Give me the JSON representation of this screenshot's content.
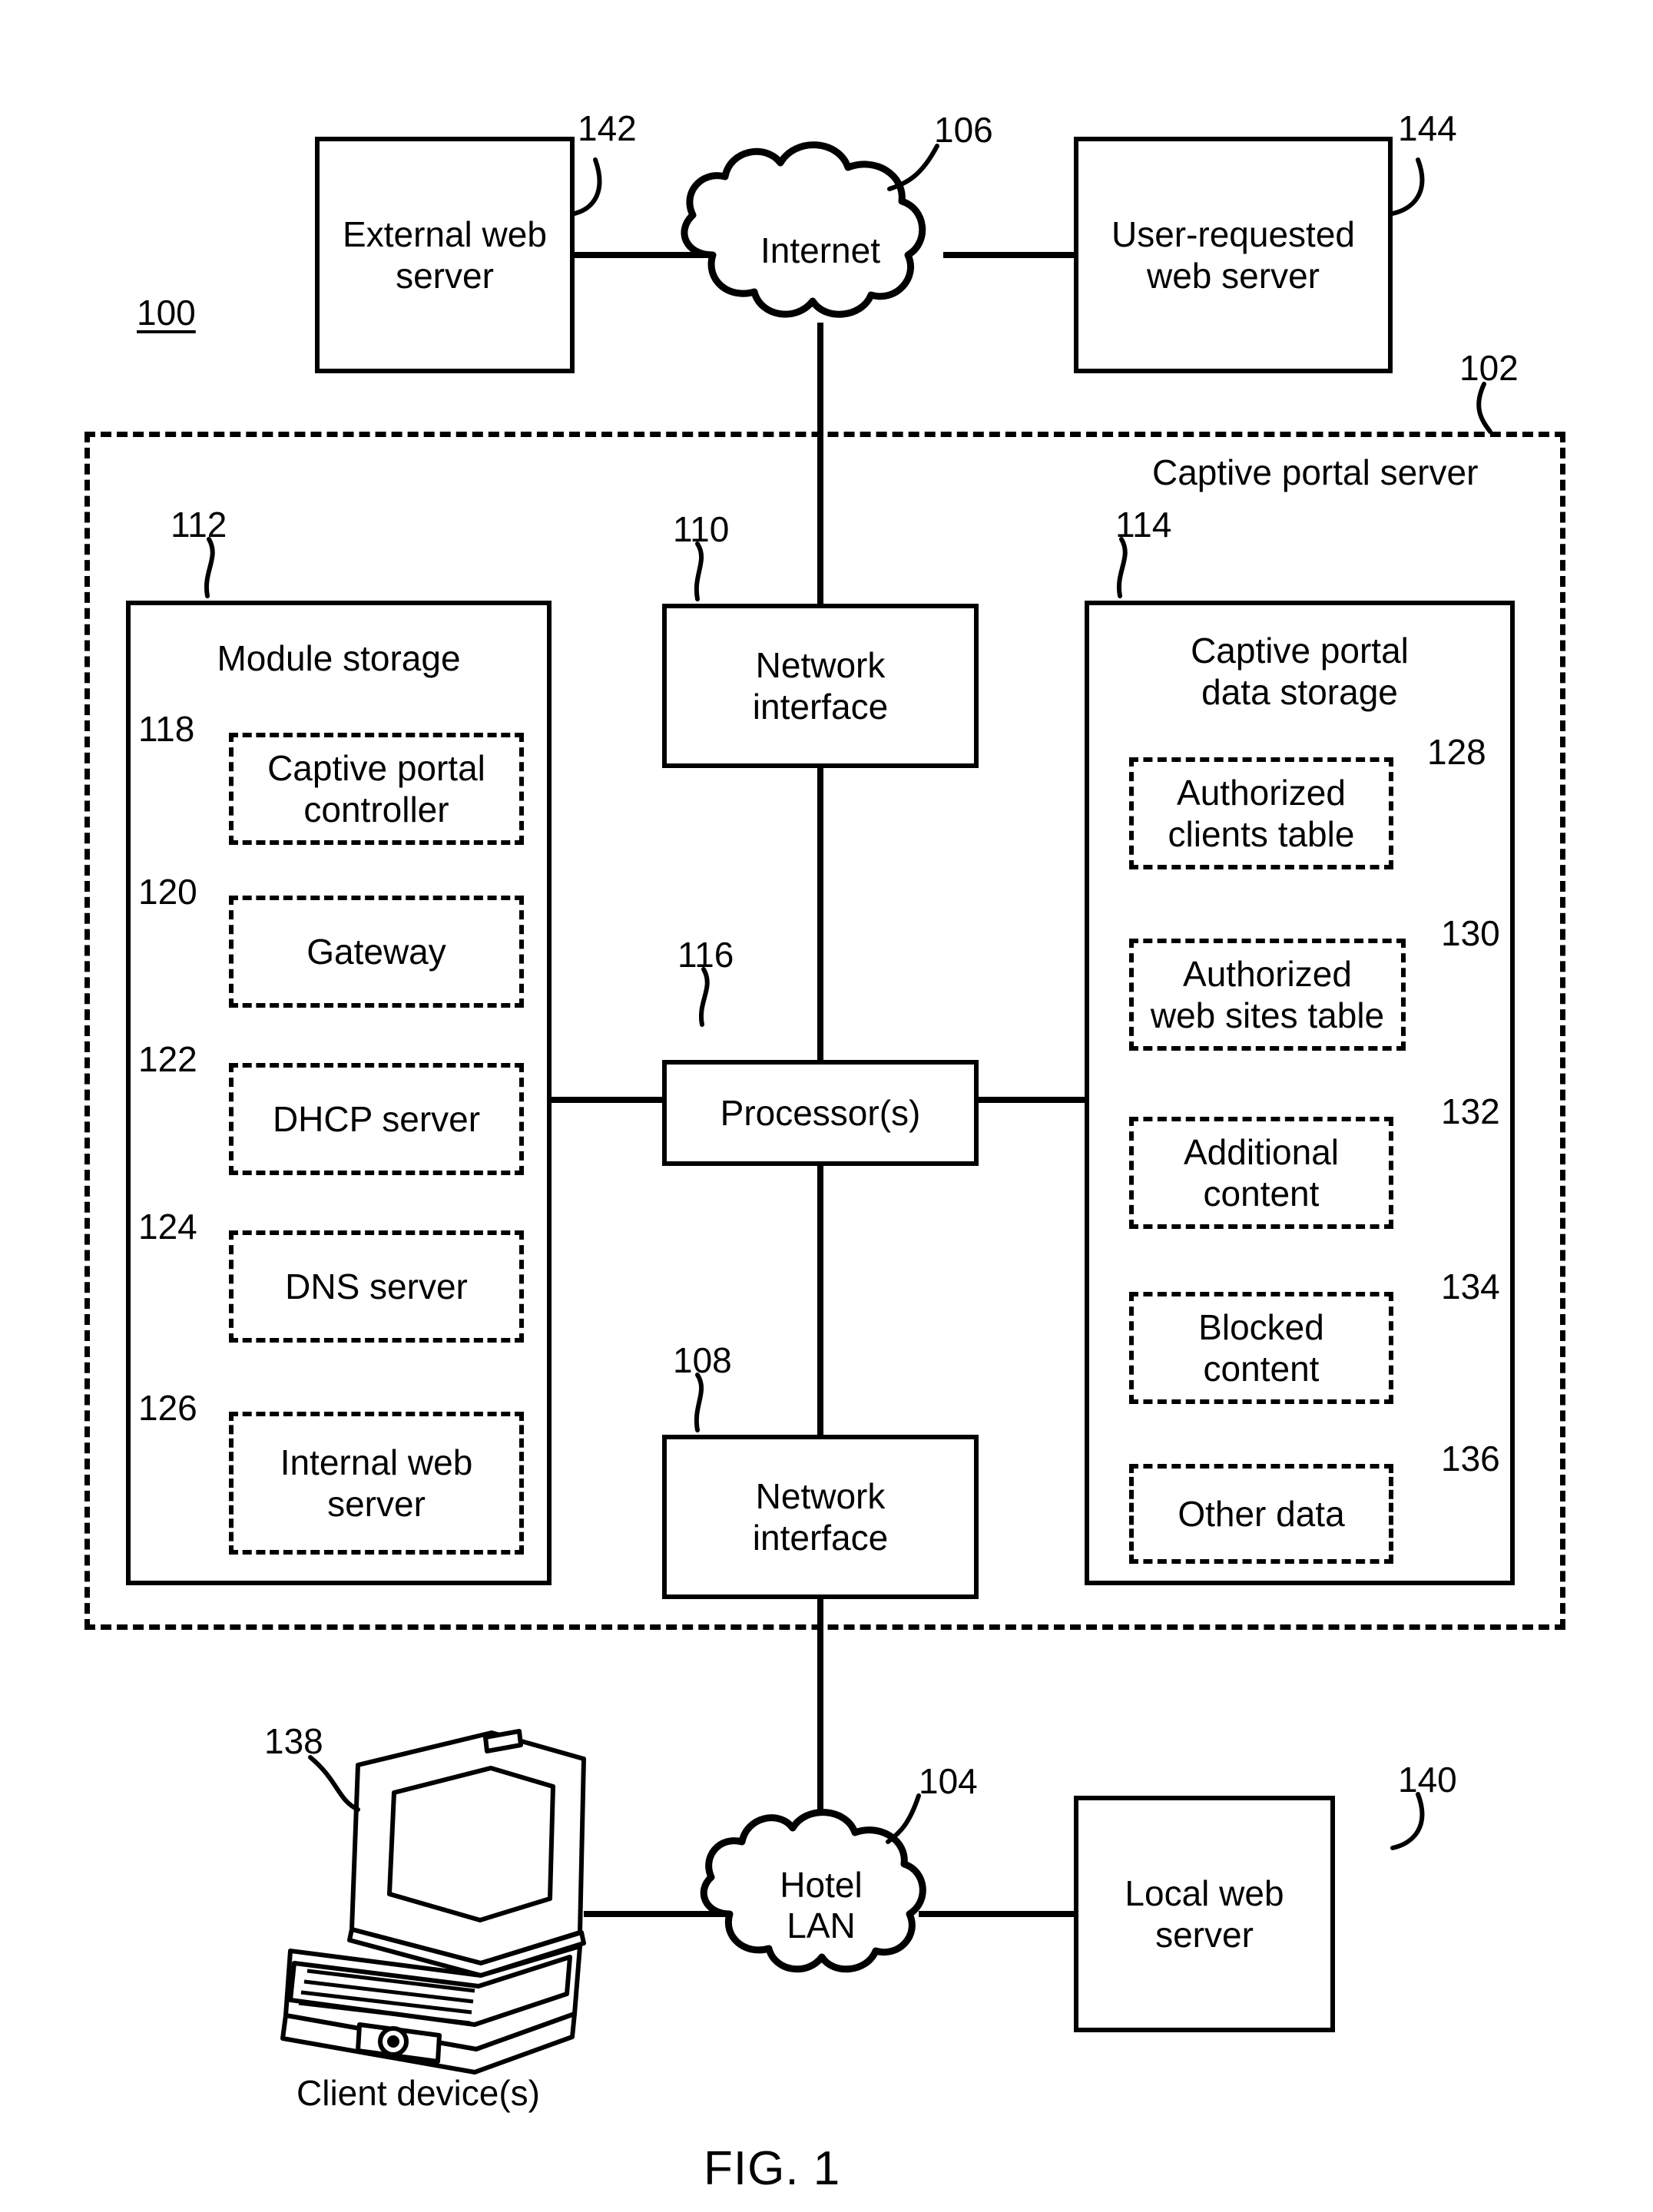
{
  "figure": {
    "caption": "FIG. 1",
    "system_ref": "100"
  },
  "top_nodes": {
    "external_web_server": {
      "label": "External web\nserver",
      "ref": "142"
    },
    "internet_cloud": {
      "label": "Internet",
      "ref": "106"
    },
    "user_requested_web_server": {
      "label": "User-requested\nweb server",
      "ref": "144"
    }
  },
  "captive_portal_server": {
    "label": "Captive portal server",
    "ref": "102",
    "network_interface_top": {
      "label": "Network\ninterface",
      "ref": "110"
    },
    "network_interface_bottom": {
      "label": "Network\ninterface",
      "ref": "108"
    },
    "processor": {
      "label": "Processor(s)",
      "ref": "116"
    },
    "module_storage": {
      "title": "Module storage",
      "ref": "112",
      "items": [
        {
          "label": "Captive portal\ncontroller",
          "ref": "118"
        },
        {
          "label": "Gateway",
          "ref": "120"
        },
        {
          "label": "DHCP server",
          "ref": "122"
        },
        {
          "label": "DNS server",
          "ref": "124"
        },
        {
          "label": "Internal web\nserver",
          "ref": "126"
        }
      ]
    },
    "data_storage": {
      "title": "Captive portal\ndata storage",
      "ref": "114",
      "items": [
        {
          "label": "Authorized\nclients table",
          "ref": "128"
        },
        {
          "label": "Authorized\nweb sites table",
          "ref": "130"
        },
        {
          "label": "Additional\ncontent",
          "ref": "132"
        },
        {
          "label": "Blocked\ncontent",
          "ref": "134"
        },
        {
          "label": "Other data",
          "ref": "136"
        }
      ]
    }
  },
  "bottom_nodes": {
    "client_device": {
      "caption": "Client device(s)",
      "ref": "138"
    },
    "hotel_lan_cloud": {
      "label": "Hotel\nLAN",
      "ref": "104"
    },
    "local_web_server": {
      "label": "Local web\nserver",
      "ref": "140"
    }
  }
}
